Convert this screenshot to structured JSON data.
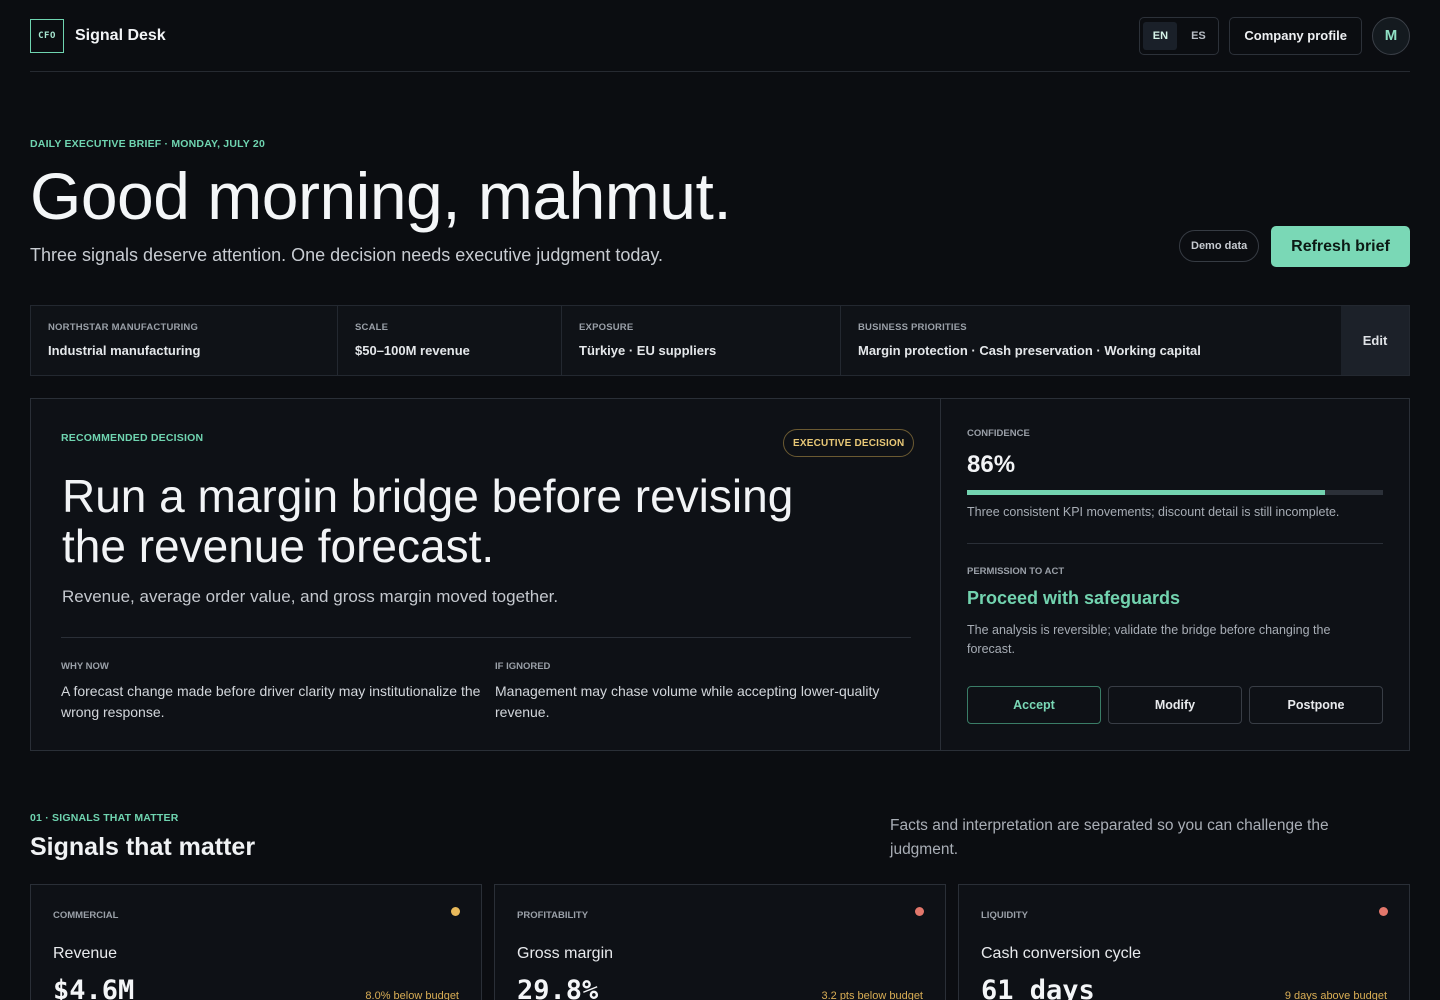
{
  "header": {
    "logo_text": "CFO",
    "brand": "Signal Desk",
    "languages": [
      {
        "label": "EN",
        "active": true
      },
      {
        "label": "ES",
        "active": false
      }
    ],
    "company_profile_label": "Company profile",
    "avatar_initial": "M"
  },
  "hero": {
    "eyebrow": "Daily executive brief · Monday, July 20",
    "greeting": "Good morning, mahmut.",
    "subtitle": "Three signals deserve attention. One decision needs executive judgment today.",
    "demo_label": "Demo data",
    "refresh_label": "Refresh brief"
  },
  "profile": {
    "cells": [
      {
        "label": "Northstar Manufacturing",
        "value": "Industrial manufacturing"
      },
      {
        "label": "Scale",
        "value": "$50–100M revenue"
      },
      {
        "label": "Exposure",
        "value": "Türkiye · EU suppliers"
      },
      {
        "label": "Business priorities",
        "value": "Margin protection · Cash preservation · Working capital"
      }
    ],
    "edit_label": "Edit"
  },
  "decision": {
    "eyebrow": "Recommended decision",
    "badge": "Executive decision",
    "title": "Run a margin bridge before revising the revenue forecast.",
    "subtitle": "Revenue, average order value, and gross margin moved together.",
    "why_now_label": "Why now",
    "why_now_text": "A forecast change made before driver clarity may institutionalize the wrong response.",
    "if_ignored_label": "If ignored",
    "if_ignored_text": "Management may chase volume while accepting lower-quality revenue.",
    "confidence_label": "Confidence",
    "confidence_value": "86%",
    "confidence_fraction": 0.86,
    "confidence_note": "Three consistent KPI movements; discount detail is still incomplete.",
    "permission_label": "Permission to act",
    "permission_value": "Proceed with safeguards",
    "permission_note": "The analysis is reversible; validate the bridge before changing the forecast.",
    "actions": {
      "accept": "Accept",
      "modify": "Modify",
      "postpone": "Postpone"
    }
  },
  "signals": {
    "eyebrow": "01 · Signals that matter",
    "title": "Signals that matter",
    "note": "Facts and interpretation are separated so you can challenge the judgment.",
    "cards": [
      {
        "category": "Commercial",
        "name": "Revenue",
        "value": "$4.6M",
        "delta": "8.0% below budget",
        "dot_color": "#e8b95a",
        "delta_color": "#d9ae55"
      },
      {
        "category": "Profitability",
        "name": "Gross margin",
        "value": "29.8%",
        "delta": "3.2 pts below budget",
        "dot_color": "#e2776b",
        "delta_color": "#d9ae55"
      },
      {
        "category": "Liquidity",
        "name": "Cash conversion cycle",
        "value": "61 days",
        "delta": "9 days above budget",
        "dot_color": "#e2776b",
        "delta_color": "#d9ae55"
      }
    ]
  }
}
